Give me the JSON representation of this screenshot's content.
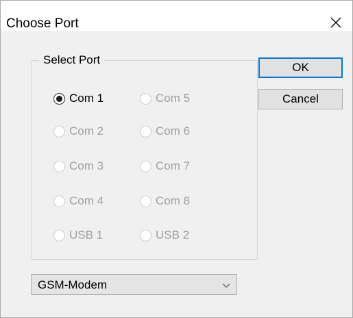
{
  "window": {
    "title": "Choose Port",
    "close_icon": "close-icon"
  },
  "port_group": {
    "legend": "Select Port",
    "options": [
      {
        "label": "Com 1",
        "checked": true,
        "enabled": true
      },
      {
        "label": "Com 5",
        "checked": false,
        "enabled": false
      },
      {
        "label": "Com 2",
        "checked": false,
        "enabled": false
      },
      {
        "label": "Com 6",
        "checked": false,
        "enabled": false
      },
      {
        "label": "Com 3",
        "checked": false,
        "enabled": false
      },
      {
        "label": "Com 7",
        "checked": false,
        "enabled": false
      },
      {
        "label": "Com 4",
        "checked": false,
        "enabled": false
      },
      {
        "label": "Com 8",
        "checked": false,
        "enabled": false
      },
      {
        "label": "USB 1",
        "checked": false,
        "enabled": false
      },
      {
        "label": "USB 2",
        "checked": false,
        "enabled": false
      }
    ]
  },
  "buttons": {
    "ok_label": "OK",
    "cancel_label": "Cancel"
  },
  "device_select": {
    "selected": "GSM-Modem",
    "icon": "chevron-down-icon"
  },
  "colors": {
    "dialog_background": "#f0f0f0",
    "default_button_border": "#0078d7",
    "disabled_text": "#a0a0a0"
  }
}
